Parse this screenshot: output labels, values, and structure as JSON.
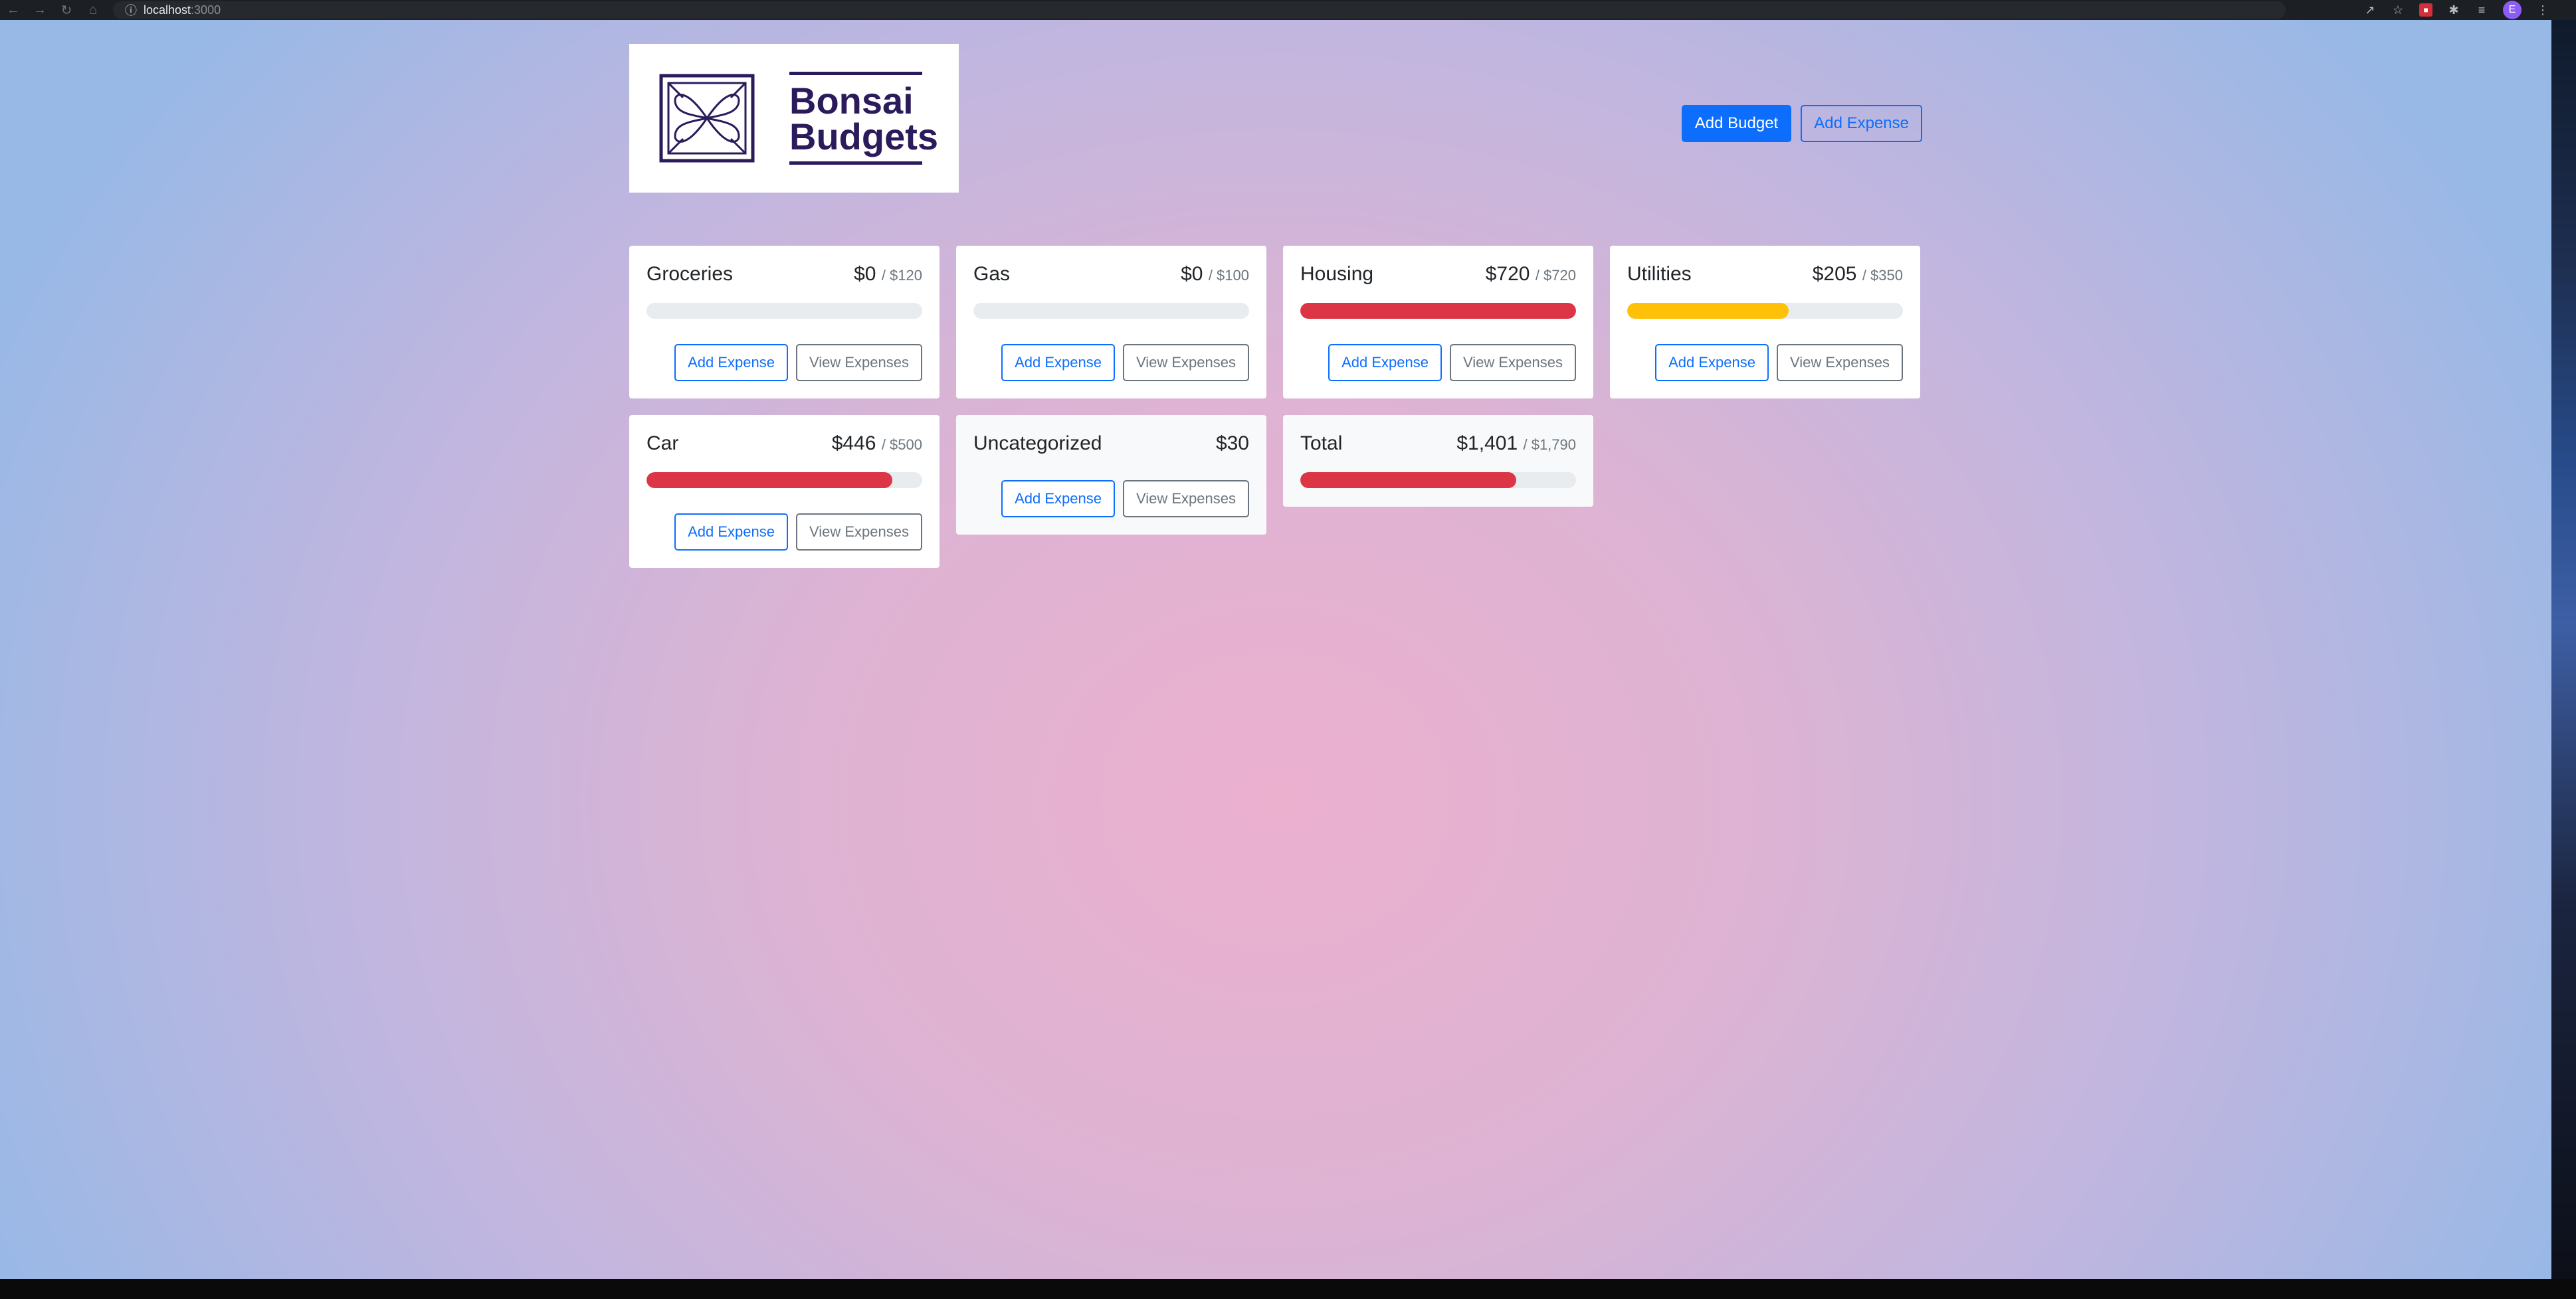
{
  "browser": {
    "url_host": "localhost",
    "url_port": ":3000",
    "profile_initial": "E"
  },
  "brand": {
    "name_line1": "Bonsai",
    "name_line2": "Budgets"
  },
  "header": {
    "add_budget_label": "Add Budget",
    "add_expense_label": "Add Expense"
  },
  "colors": {
    "primary": "#0d6efd",
    "danger": "#dc3545",
    "warning": "#ffc107",
    "brand": "#2b1b5a"
  },
  "budgets": [
    {
      "name": "Groceries",
      "spent": "$0",
      "max": "/ $120",
      "progress": 0,
      "bar_color": "#dc3545",
      "add_label": "Add Expense",
      "view_label": "View Expenses"
    },
    {
      "name": "Gas",
      "spent": "$0",
      "max": "/ $100",
      "progress": 0,
      "bar_color": "#dc3545",
      "add_label": "Add Expense",
      "view_label": "View Expenses"
    },
    {
      "name": "Housing",
      "spent": "$720",
      "max": "/ $720",
      "progress": 1.0,
      "bar_color": "#dc3545",
      "add_label": "Add Expense",
      "view_label": "View Expenses"
    },
    {
      "name": "Utilities",
      "spent": "$205",
      "max": "/ $350",
      "progress": 0.586,
      "bar_color": "#ffc107",
      "add_label": "Add Expense",
      "view_label": "View Expenses"
    },
    {
      "name": "Car",
      "spent": "$446",
      "max": "/ $500",
      "progress": 0.892,
      "bar_color": "#dc3545",
      "add_label": "Add Expense",
      "view_label": "View Expenses"
    }
  ],
  "uncategorized": {
    "name": "Uncategorized",
    "spent": "$30",
    "add_label": "Add Expense",
    "view_label": "View Expenses"
  },
  "total": {
    "name": "Total",
    "spent": "$1,401",
    "max": "/ $1,790",
    "progress": 0.783,
    "bar_color": "#dc3545"
  }
}
